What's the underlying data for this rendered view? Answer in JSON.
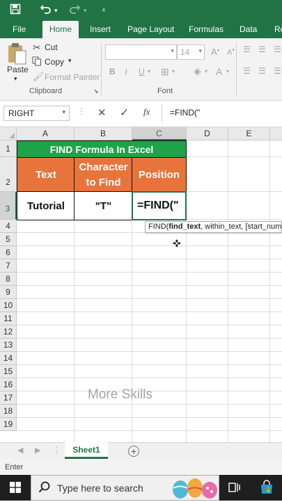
{
  "qat": {
    "icons": [
      "save-icon",
      "undo-icon",
      "redo-icon",
      "customize-icon"
    ]
  },
  "ribbon_tabs": [
    "File",
    "Home",
    "Insert",
    "Page Layout",
    "Formulas",
    "Data",
    "Re"
  ],
  "active_tab": "Home",
  "clipboard": {
    "paste": "Paste",
    "cut": "Cut",
    "copy": "Copy",
    "format_painter": "Format Painter",
    "group_label": "Clipboard"
  },
  "font": {
    "name_value": "",
    "size_value": "14",
    "bold": "B",
    "italic": "I",
    "underline": "U",
    "group_label": "Font"
  },
  "formula_bar": {
    "name_box": "RIGHT",
    "cancel": "✕",
    "enter": "✓",
    "fx": "fx",
    "formula": "=FIND(\""
  },
  "columns": [
    "A",
    "B",
    "C",
    "D",
    "E"
  ],
  "rows": [
    "1",
    "2",
    "3",
    "4",
    "5",
    "6",
    "7",
    "8",
    "9",
    "10",
    "11",
    "12",
    "13",
    "14",
    "15",
    "16",
    "17",
    "18",
    "19"
  ],
  "table": {
    "title": "FIND Formula In Excel",
    "headers": [
      "Text",
      "Character to Find",
      "Position"
    ],
    "row": [
      "Tutorial",
      "\"T\"",
      "=FIND(\""
    ],
    "colors": {
      "title_bg": "#1fa34a",
      "header_bg": "#e8743b",
      "text": "#ffffff"
    }
  },
  "tooltip": {
    "prefix": "FIND(",
    "bold_arg": "find_text",
    "rest": ", within_text, [start_num"
  },
  "watermark": "More Skills",
  "sheets": {
    "active": "Sheet1"
  },
  "status": {
    "mode": "Enter"
  },
  "taskbar": {
    "search_placeholder": "Type here to search"
  },
  "colors": {
    "excel_green": "#217346",
    "taskbar": "#1f1f1f"
  }
}
